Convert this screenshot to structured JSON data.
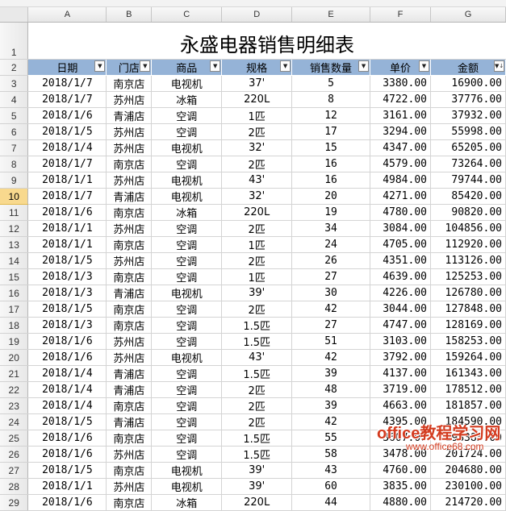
{
  "columns": [
    "A",
    "B",
    "C",
    "D",
    "E",
    "F",
    "G"
  ],
  "title": "永盛电器销售明细表",
  "headers": [
    "日期",
    "门店",
    "商品",
    "规格",
    "销售数量",
    "单价",
    "金额"
  ],
  "selected_row": "10",
  "rows": [
    {
      "n": "3",
      "date": "2018/1/7",
      "store": "南京店",
      "product": "电视机",
      "spec": "37'",
      "qty": "5",
      "price": "3380.00",
      "amount": "16900.00"
    },
    {
      "n": "4",
      "date": "2018/1/7",
      "store": "苏州店",
      "product": "冰箱",
      "spec": "220L",
      "qty": "8",
      "price": "4722.00",
      "amount": "37776.00"
    },
    {
      "n": "5",
      "date": "2018/1/6",
      "store": "青浦店",
      "product": "空调",
      "spec": "1匹",
      "qty": "12",
      "price": "3161.00",
      "amount": "37932.00"
    },
    {
      "n": "6",
      "date": "2018/1/5",
      "store": "苏州店",
      "product": "空调",
      "spec": "2匹",
      "qty": "17",
      "price": "3294.00",
      "amount": "55998.00"
    },
    {
      "n": "7",
      "date": "2018/1/4",
      "store": "苏州店",
      "product": "电视机",
      "spec": "32'",
      "qty": "15",
      "price": "4347.00",
      "amount": "65205.00"
    },
    {
      "n": "8",
      "date": "2018/1/7",
      "store": "南京店",
      "product": "空调",
      "spec": "2匹",
      "qty": "16",
      "price": "4579.00",
      "amount": "73264.00"
    },
    {
      "n": "9",
      "date": "2018/1/1",
      "store": "苏州店",
      "product": "电视机",
      "spec": "43'",
      "qty": "16",
      "price": "4984.00",
      "amount": "79744.00"
    },
    {
      "n": "10",
      "date": "2018/1/7",
      "store": "青浦店",
      "product": "电视机",
      "spec": "32'",
      "qty": "20",
      "price": "4271.00",
      "amount": "85420.00"
    },
    {
      "n": "11",
      "date": "2018/1/6",
      "store": "南京店",
      "product": "冰箱",
      "spec": "220L",
      "qty": "19",
      "price": "4780.00",
      "amount": "90820.00"
    },
    {
      "n": "12",
      "date": "2018/1/1",
      "store": "苏州店",
      "product": "空调",
      "spec": "2匹",
      "qty": "34",
      "price": "3084.00",
      "amount": "104856.00"
    },
    {
      "n": "13",
      "date": "2018/1/1",
      "store": "南京店",
      "product": "空调",
      "spec": "1匹",
      "qty": "24",
      "price": "4705.00",
      "amount": "112920.00"
    },
    {
      "n": "14",
      "date": "2018/1/5",
      "store": "苏州店",
      "product": "空调",
      "spec": "2匹",
      "qty": "26",
      "price": "4351.00",
      "amount": "113126.00"
    },
    {
      "n": "15",
      "date": "2018/1/3",
      "store": "南京店",
      "product": "空调",
      "spec": "1匹",
      "qty": "27",
      "price": "4639.00",
      "amount": "125253.00"
    },
    {
      "n": "16",
      "date": "2018/1/3",
      "store": "青浦店",
      "product": "电视机",
      "spec": "39'",
      "qty": "30",
      "price": "4226.00",
      "amount": "126780.00"
    },
    {
      "n": "17",
      "date": "2018/1/5",
      "store": "南京店",
      "product": "空调",
      "spec": "2匹",
      "qty": "42",
      "price": "3044.00",
      "amount": "127848.00"
    },
    {
      "n": "18",
      "date": "2018/1/3",
      "store": "南京店",
      "product": "空调",
      "spec": "1.5匹",
      "qty": "27",
      "price": "4747.00",
      "amount": "128169.00"
    },
    {
      "n": "19",
      "date": "2018/1/6",
      "store": "苏州店",
      "product": "空调",
      "spec": "1.5匹",
      "qty": "51",
      "price": "3103.00",
      "amount": "158253.00"
    },
    {
      "n": "20",
      "date": "2018/1/6",
      "store": "苏州店",
      "product": "电视机",
      "spec": "43'",
      "qty": "42",
      "price": "3792.00",
      "amount": "159264.00"
    },
    {
      "n": "21",
      "date": "2018/1/4",
      "store": "青浦店",
      "product": "空调",
      "spec": "1.5匹",
      "qty": "39",
      "price": "4137.00",
      "amount": "161343.00"
    },
    {
      "n": "22",
      "date": "2018/1/4",
      "store": "青浦店",
      "product": "空调",
      "spec": "2匹",
      "qty": "48",
      "price": "3719.00",
      "amount": "178512.00"
    },
    {
      "n": "23",
      "date": "2018/1/4",
      "store": "南京店",
      "product": "空调",
      "spec": "2匹",
      "qty": "39",
      "price": "4663.00",
      "amount": "181857.00"
    },
    {
      "n": "24",
      "date": "2018/1/5",
      "store": "青浦店",
      "product": "空调",
      "spec": "2匹",
      "qty": "42",
      "price": "4395.00",
      "amount": "184590.00"
    },
    {
      "n": "25",
      "date": "2018/1/6",
      "store": "南京店",
      "product": "空调",
      "spec": "1.5匹",
      "qty": "55",
      "price": "3607.00",
      "amount": "198385.00"
    },
    {
      "n": "26",
      "date": "2018/1/6",
      "store": "苏州店",
      "product": "空调",
      "spec": "1.5匹",
      "qty": "58",
      "price": "3478.00",
      "amount": "201724.00"
    },
    {
      "n": "27",
      "date": "2018/1/5",
      "store": "南京店",
      "product": "电视机",
      "spec": "39'",
      "qty": "43",
      "price": "4760.00",
      "amount": "204680.00"
    },
    {
      "n": "28",
      "date": "2018/1/1",
      "store": "苏州店",
      "product": "电视机",
      "spec": "39'",
      "qty": "60",
      "price": "3835.00",
      "amount": "230100.00"
    },
    {
      "n": "29",
      "date": "2018/1/6",
      "store": "南京店",
      "product": "冰箱",
      "spec": "220L",
      "qty": "44",
      "price": "4880.00",
      "amount": "214720.00"
    }
  ],
  "watermark": {
    "brand_latin": "office",
    "brand_cn": "教程学习网",
    "url": "www.office68.com"
  },
  "colors": {
    "header_fill": "#95b3d7",
    "selected_row_header": "#f8d98e",
    "gridline": "#d4d4d4",
    "watermark": "#d33b1f"
  }
}
